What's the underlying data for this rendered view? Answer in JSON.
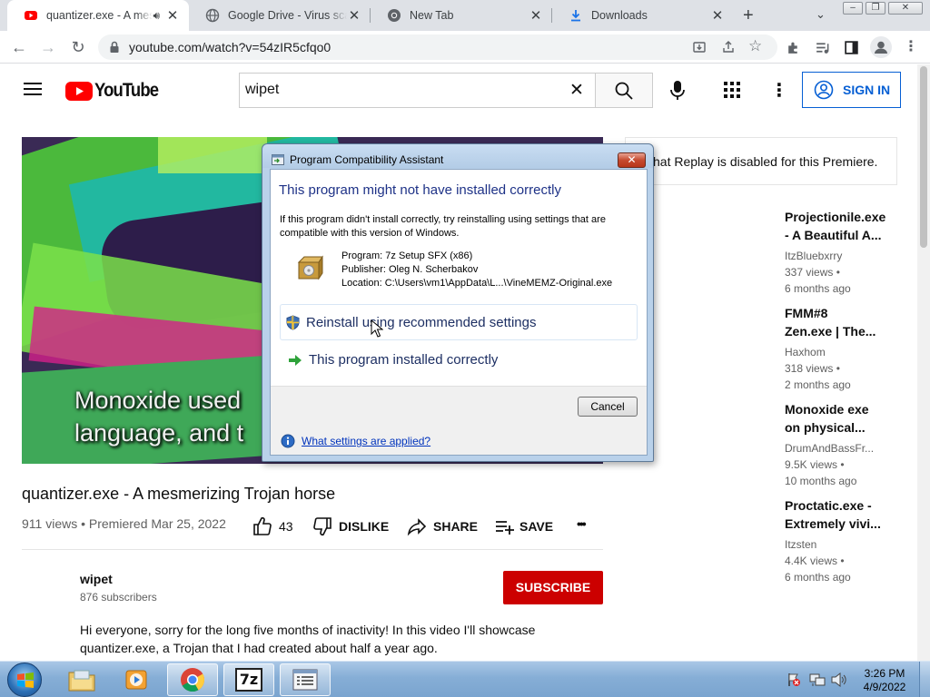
{
  "browser": {
    "tabs": [
      {
        "title": "quantizer.exe - A mesmerizing Trojan horse",
        "close": "✕"
      },
      {
        "title": "Google Drive - Virus scan warning",
        "close": "✕"
      },
      {
        "title": "New Tab",
        "close": "✕"
      },
      {
        "title": "Downloads",
        "close": "✕"
      }
    ],
    "new_tab": "+",
    "url": "youtube.com/watch?v=54zIR5cfqo0"
  },
  "youtube": {
    "logo_text": "YouTube",
    "search": {
      "value": "wipet",
      "placeholder": "Search"
    },
    "signin_label": "SIGN IN",
    "video": {
      "caption_line1": "Monoxide used",
      "caption_line2": "language, and t",
      "title": "quantizer.exe - A mesmerizing Trojan horse",
      "meta": "911 views • Premiered Mar 25, 2022",
      "likes": "43",
      "dislike_label": "DISLIKE",
      "share_label": "SHARE",
      "save_label": "SAVE",
      "more": "•••"
    },
    "channel": {
      "name": "wipet",
      "subscribers": "876 subscribers",
      "subscribe_label": "SUBSCRIBE"
    },
    "description": {
      "line1": "Hi everyone, sorry for the long five months of inactivity! In this video I'll showcase",
      "line2": "quantizer.exe, a Trojan that I had created about half a year ago."
    },
    "chat_notice": "hat Replay is disabled for this Premiere.",
    "recommendations": [
      {
        "title1": "Projectionile.exe",
        "title2": "- A Beautiful A...",
        "channel": "ItzBluebxrry",
        "views": "337 views •",
        "age": "6 months ago"
      },
      {
        "title1": "FMM#8",
        "title2": "Zen.exe | The...",
        "channel": "Haxhom",
        "views": "318 views •",
        "age": "2 months ago"
      },
      {
        "title1": "Monoxide exe",
        "title2": "on physical...",
        "channel": "DrumAndBassFr...",
        "views": "9.5K views •",
        "age": "10 months ago"
      },
      {
        "title1": "Proctatic.exe -",
        "title2": "Extremely vivi...",
        "channel": "Itzsten",
        "views": "4.4K views •",
        "age": "6 months ago"
      }
    ]
  },
  "dialog": {
    "title": "Program Compatibility Assistant",
    "close": "✕",
    "heading": "This program might not have installed correctly",
    "text": "If this program didn't install correctly, try reinstalling using settings that are compatible with this version of Windows.",
    "program": "Program: 7z Setup SFX (x86)",
    "publisher": "Publisher: Oleg N. Scherbakov",
    "location": "Location: C:\\Users\\vm1\\AppData\\L...\\VineMEMZ-Original.exe",
    "option_reinstall": "Reinstall using recommended settings",
    "option_correct": "This program installed correctly",
    "cancel_label": "Cancel",
    "help_link": "What settings are applied?"
  },
  "taskbar": {
    "time": "3:26 PM",
    "date": "4/9/2022",
    "items": [
      "windows-explorer",
      "media-player",
      "chrome",
      "7zip",
      "program-window"
    ]
  },
  "colors": {
    "youtube_red": "#ff0000",
    "subscribe_red": "#cc0000",
    "signin_blue": "#065fd4",
    "dialog_heading": "#1e3287"
  }
}
